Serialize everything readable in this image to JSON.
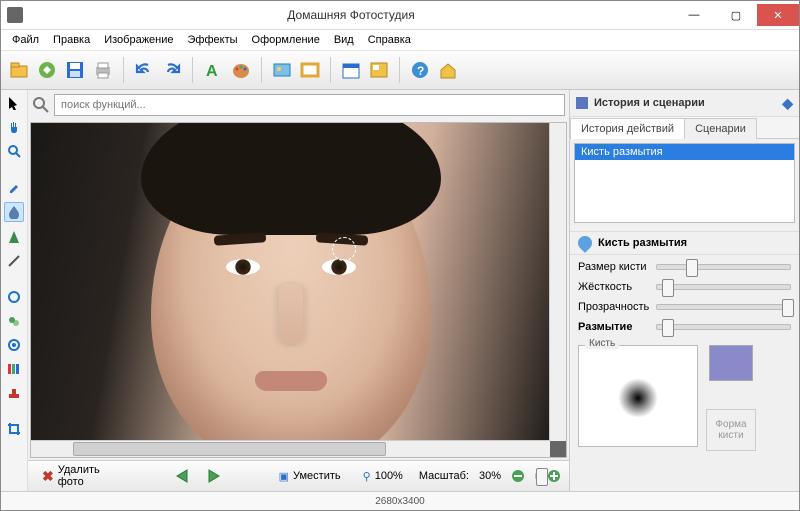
{
  "title": "Домашняя Фотостудия",
  "menu": [
    "Файл",
    "Правка",
    "Изображение",
    "Эффекты",
    "Оформление",
    "Вид",
    "Справка"
  ],
  "search": {
    "placeholder": "поиск функций..."
  },
  "history_panel": {
    "title": "История и сценарии",
    "tabs": [
      "История действий",
      "Сценарии"
    ],
    "items": [
      "Кисть размытия"
    ]
  },
  "brush_panel": {
    "title": "Кисть размытия",
    "sliders": [
      {
        "label": "Размер кисти",
        "pos": 22,
        "bold": false
      },
      {
        "label": "Жёсткость",
        "pos": 4,
        "bold": false
      },
      {
        "label": "Прозрачность",
        "pos": 96,
        "bold": false
      },
      {
        "label": "Размытие",
        "pos": 4,
        "bold": true
      }
    ],
    "brush_label": "Кисть",
    "shape_label": "Форма кисти",
    "swatch_color": "#8a8acb"
  },
  "bottom": {
    "delete": "Удалить фото",
    "fit": "Уместить",
    "percent": "100%",
    "scale_label": "Масштаб:",
    "scale_value": "30%"
  },
  "status": {
    "dims": "2680x3400"
  }
}
